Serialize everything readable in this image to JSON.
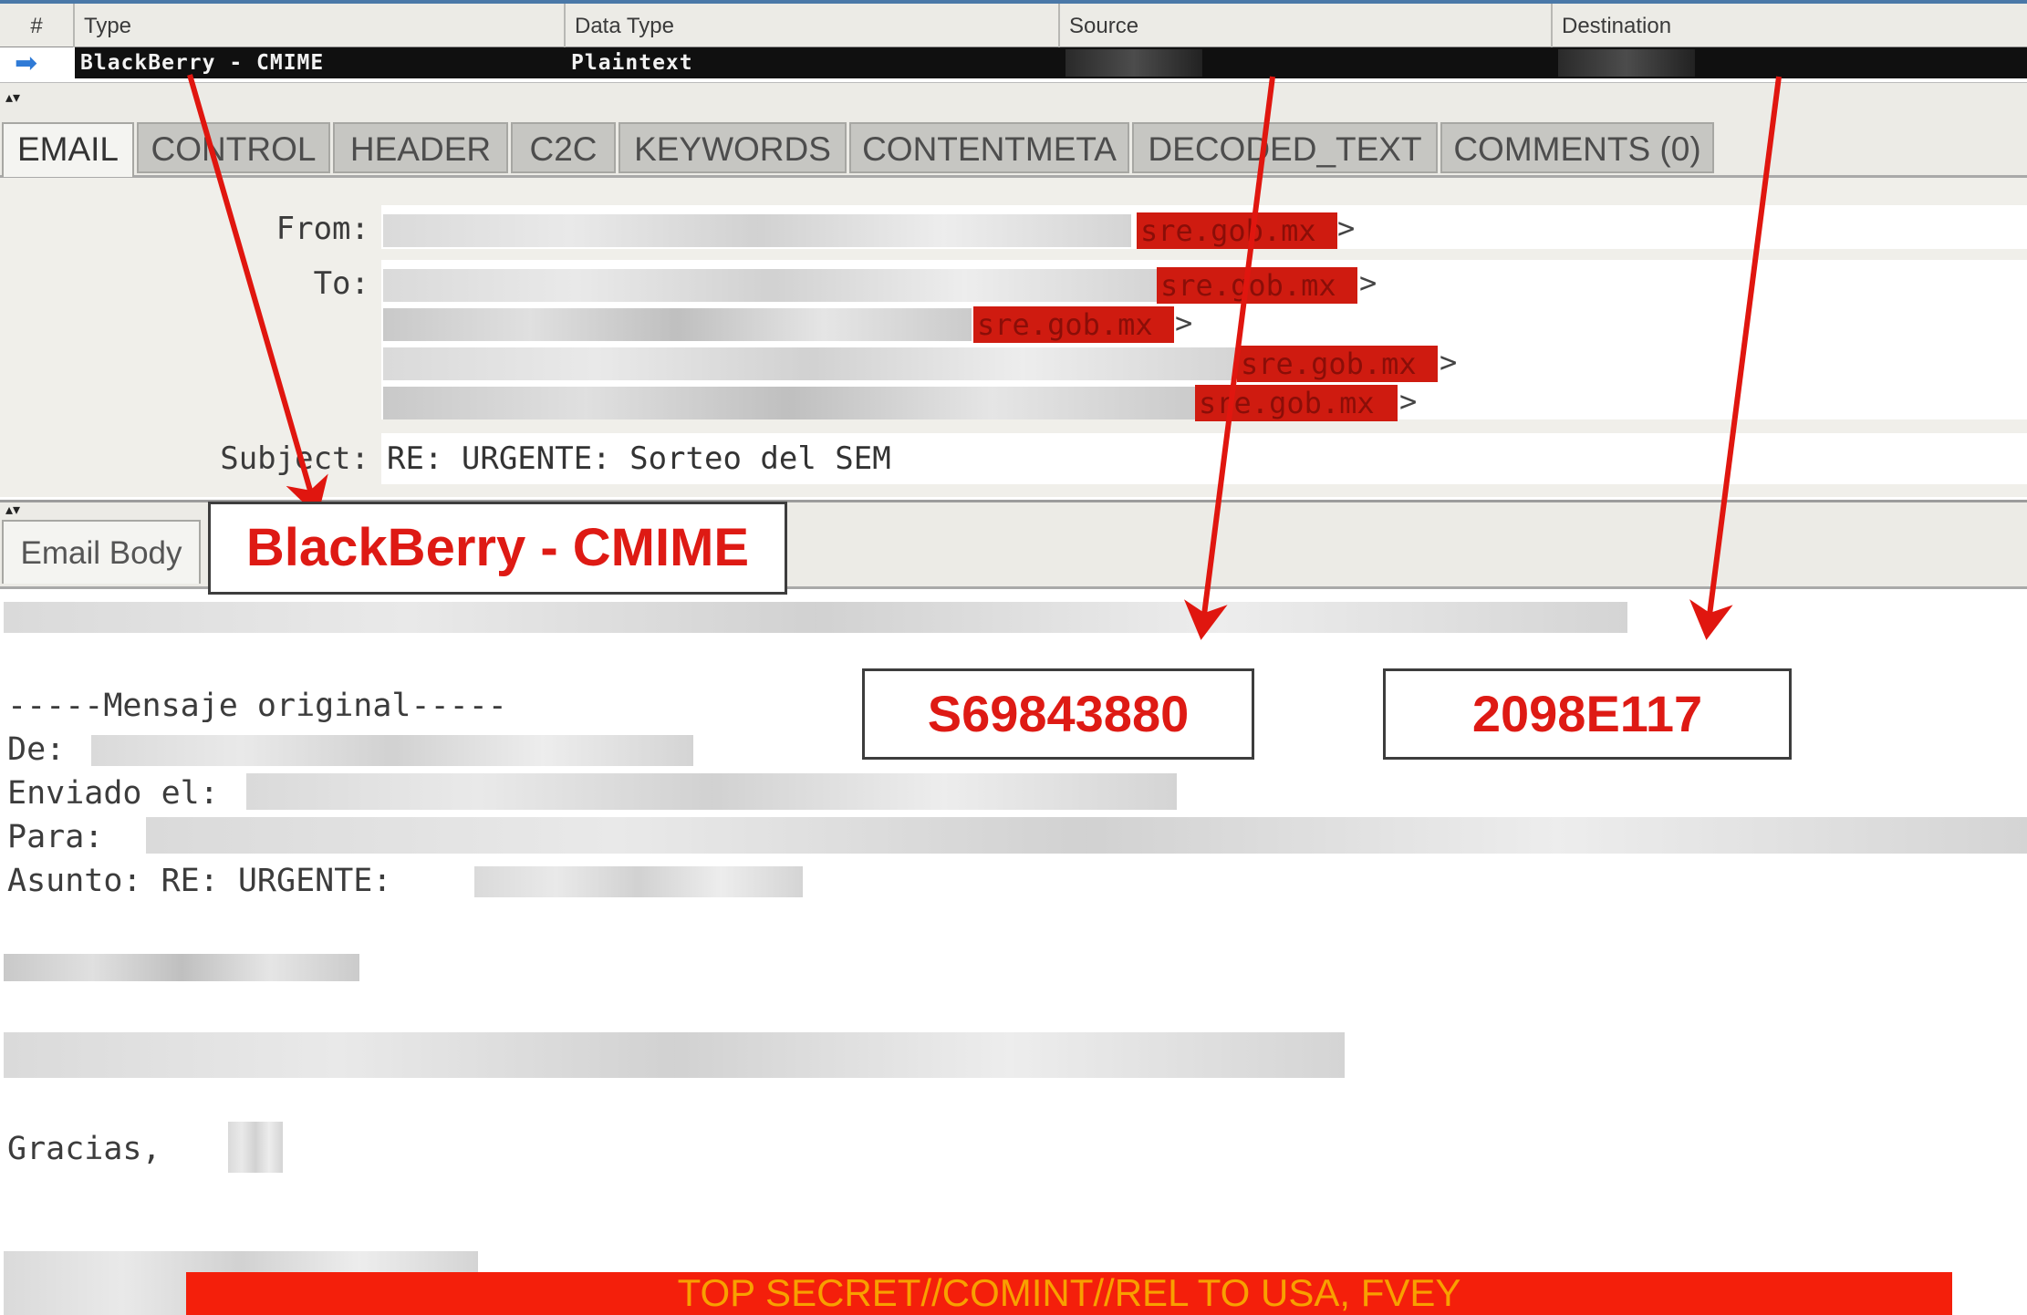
{
  "table": {
    "columns": [
      "#",
      "Type",
      "Data Type",
      "Source",
      "Destination"
    ],
    "row": {
      "type": "BlackBerry - CMIME",
      "data_type": "Plaintext"
    }
  },
  "tabs": [
    "EMAIL",
    "CONTROL",
    "HEADER",
    "C2C",
    "KEYWORDS",
    "CONTENTMETA",
    "DECODED_TEXT",
    "COMMENTS (0)"
  ],
  "active_tab": "EMAIL",
  "header": {
    "from_label": "From:",
    "to_label": "To:",
    "subject_label": "Subject:",
    "subject_value": "RE: URGENTE: Sorteo del SEM",
    "from_domain": "sre.gob.mx",
    "to_domains": [
      "sre.gob.mx",
      "sre.gob.mx",
      "sre.gob.mx",
      "sre.gob.mx"
    ]
  },
  "body_tab": "Email Body",
  "body": {
    "original_marker": "-----Mensaje original-----",
    "de_label": "De:",
    "enviado_label": "Enviado el:",
    "para_label": "Para:",
    "asunto_label": "Asunto: RE: URGENTE:",
    "closing": "Gracias,"
  },
  "annotations": {
    "type_callout": "BlackBerry - CMIME",
    "source_callout": "S69843880",
    "destination_callout": "2098E117",
    "arrow_color": "#e0160f"
  },
  "banner": "TOP SECRET//COMINT//REL TO USA, FVEY",
  "colors": {
    "redaction": "#cf1b10",
    "banner_bg": "#f41f0b",
    "banner_text": "#f8a000"
  }
}
